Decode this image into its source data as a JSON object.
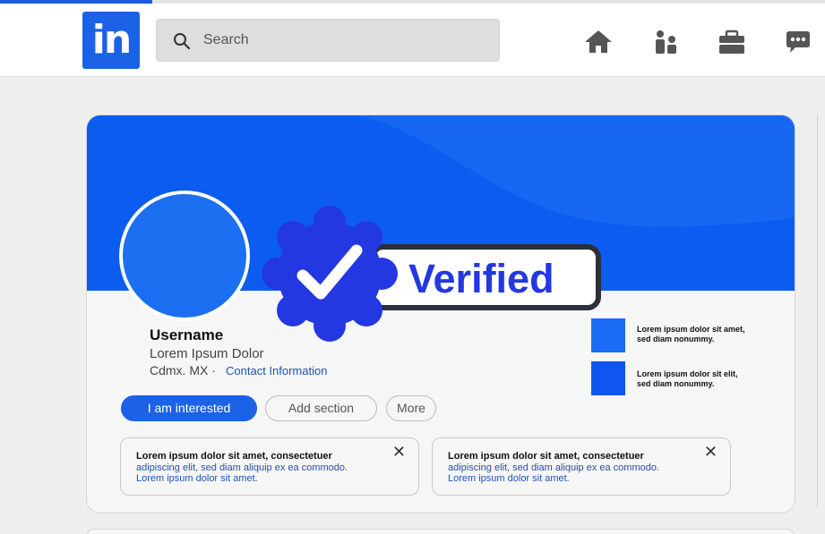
{
  "header": {
    "logo_text": "in",
    "search": {
      "placeholder": "Search",
      "value": ""
    },
    "nav_icons": [
      "home-icon",
      "network-icon",
      "jobs-icon",
      "messaging-icon"
    ]
  },
  "profile": {
    "username": "Username",
    "headline": "Lorem Ipsum Dolor",
    "location": "Cdmx. MX ·",
    "contact_label": "Contact Information",
    "buttons": {
      "interested": "I am interested",
      "add_section": "Add section",
      "more": "More"
    },
    "side_items": [
      {
        "line1": "Lorem ipsum dolor sit amet,",
        "line2": "sed diam nonummy."
      },
      {
        "line1": "Lorem ipsum dolor sit elit,",
        "line2": "sed diam nonummy."
      }
    ],
    "notices": [
      {
        "line1": "Lorem ipsum dolor sit amet, consectetuer",
        "line2": "adipiscing elit, sed diam aliquip ex ea commodo.",
        "line3": "Lorem ipsum dolor sit amet.",
        "close": "✕"
      },
      {
        "line1": "Lorem ipsum dolor sit amet, consectetuer",
        "line2": "adipiscing elit, sed diam aliquip ex ea commodo.",
        "line3": "Lorem ipsum dolor sit amet.",
        "close": "✕"
      }
    ]
  },
  "badge": {
    "label": "Verified"
  },
  "colors": {
    "brand_blue": "#1c62e6",
    "banner_blue": "#0d5cf0",
    "badge_blue": "#2338e0",
    "link_blue": "#1a55b8"
  }
}
